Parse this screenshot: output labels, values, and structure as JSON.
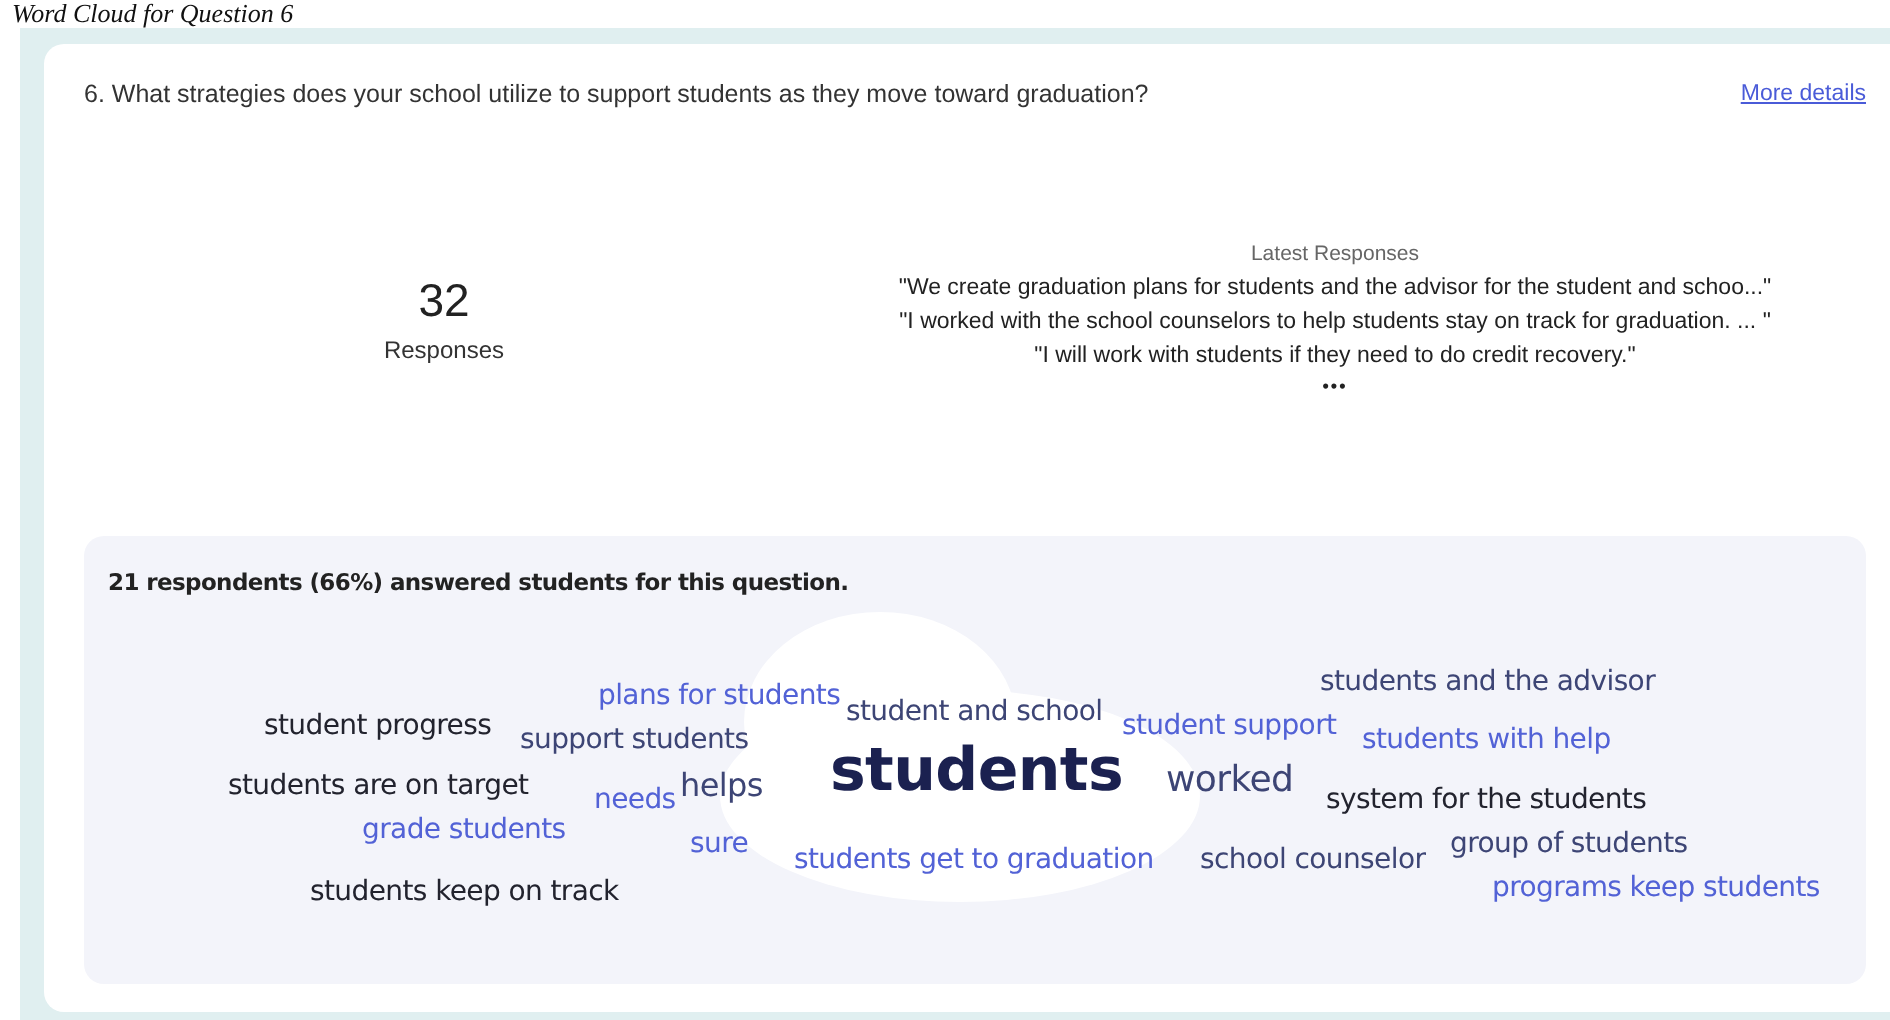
{
  "page_title": "Word Cloud for Question 6",
  "question": {
    "text": "6. What strategies does your school utilize to support students as they move toward graduation?",
    "link": "More details"
  },
  "summary": {
    "count": "32",
    "label": "Responses"
  },
  "latest": {
    "heading": "Latest Responses",
    "responses": [
      "\"We create graduation plans for students and the advisor for the student and schoo...\"",
      "\"I worked with the school counselors to help students stay on track for graduation. ... \"",
      "\"I will work with students if they need to do credit recovery.\""
    ],
    "more": "•••"
  },
  "cloud": {
    "caption": "21 respondents (66%) answered students for this question.",
    "words": [
      {
        "text": "student progress",
        "color": "#22232e"
      },
      {
        "text": "plans for students",
        "color": "#5262d6"
      },
      {
        "text": "support students",
        "color": "#3d4575"
      },
      {
        "text": "student and school",
        "color": "#3d4575"
      },
      {
        "text": "students and the advisor",
        "color": "#3d4575"
      },
      {
        "text": "students are on target",
        "color": "#22232e"
      },
      {
        "text": "needs",
        "color": "#5262d6"
      },
      {
        "text": "helps",
        "color": "#3d4575"
      },
      {
        "text": "students",
        "color": "#1b2150"
      },
      {
        "text": "student support",
        "color": "#5262d6"
      },
      {
        "text": "students with help",
        "color": "#5262d6"
      },
      {
        "text": "worked",
        "color": "#3d4575"
      },
      {
        "text": "system for the students",
        "color": "#22232e"
      },
      {
        "text": "grade students",
        "color": "#5262d6"
      },
      {
        "text": "sure",
        "color": "#5262d6"
      },
      {
        "text": "students keep on track",
        "color": "#22232e"
      },
      {
        "text": "students get to graduation",
        "color": "#5262d6"
      },
      {
        "text": "school counselor",
        "color": "#3d4575"
      },
      {
        "text": "group of students",
        "color": "#3d4575"
      },
      {
        "text": "programs keep students",
        "color": "#5262d6"
      }
    ]
  }
}
